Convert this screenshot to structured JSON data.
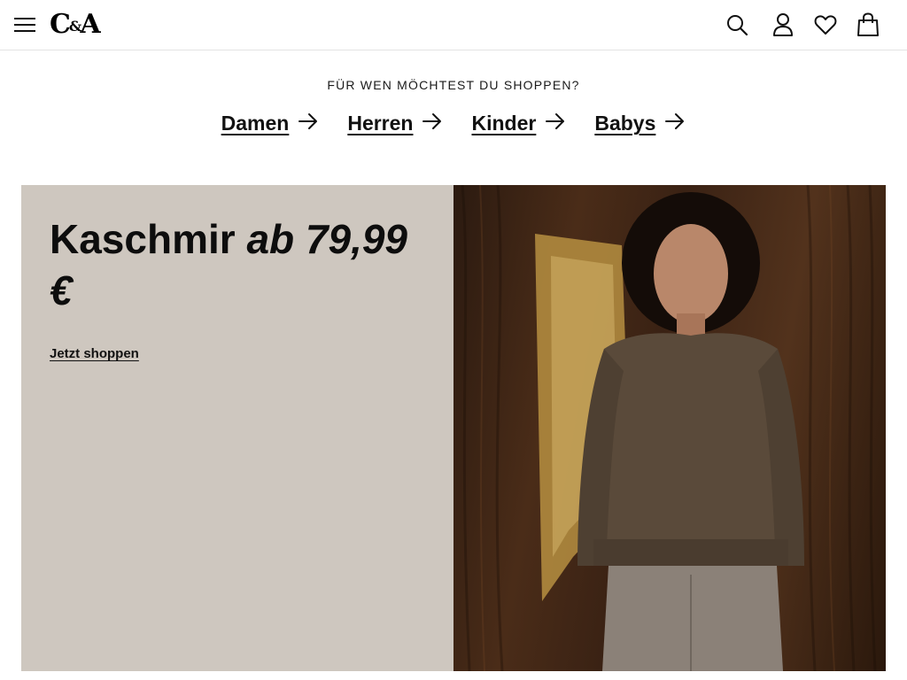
{
  "header": {
    "logo_text_c": "C",
    "logo_text_amp": "&",
    "logo_text_a": "A",
    "icons": {
      "menu": "hamburger-menu-icon",
      "search": "search-icon",
      "account": "user-icon",
      "wishlist": "heart-icon",
      "cart": "shopping-bag-icon"
    }
  },
  "chooser": {
    "title": "FÜR WEN MÖCHTEST DU SHOPPEN?",
    "links": [
      {
        "label": "Damen"
      },
      {
        "label": "Herren"
      },
      {
        "label": "Kinder"
      },
      {
        "label": "Babys"
      }
    ]
  },
  "hero": {
    "headline_main": "Kaschmir",
    "headline_price": "ab 79,99 €",
    "cta_label": "Jetzt shoppen",
    "panel_color": "#cec7bf",
    "image_subject": "woman in brown cashmere sweater in front of wooden door"
  }
}
